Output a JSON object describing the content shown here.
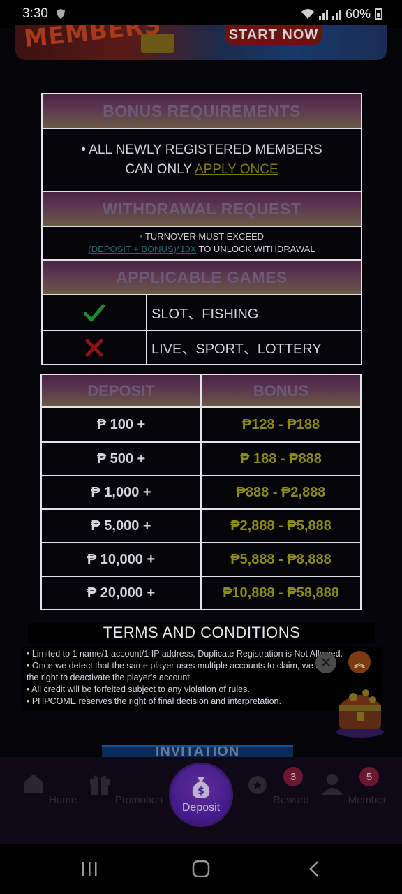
{
  "status_bar": {
    "time": "3:30",
    "battery": "60%"
  },
  "banner": {
    "members_text": "MEMBERS",
    "button_label": "START NOW"
  },
  "bonus_requirements": {
    "header": "BONUS REQUIREMENTS",
    "line1": "• ALL NEWLY REGISTERED MEMBERS",
    "line2_prefix": "CAN ONLY ",
    "line2_link": "APPLY ONCE"
  },
  "withdrawal_request": {
    "header": "WITHDRAWAL REQUEST",
    "line1_dot": "•",
    "line1": " TURNOVER MUST EXCEED",
    "line2_link": "(DEPOSIT + BONUS)*10X",
    "line2_suffix": " TO UNLOCK WITHDRAWAL"
  },
  "applicable_games": {
    "header": "APPLICABLE GAMES",
    "allowed": "SLOT、FISHING",
    "not_allowed": "LIVE、SPORT、LOTTERY",
    "colors": {
      "check": "#1f8a2a",
      "cross": "#8a1512"
    }
  },
  "deposit_table": {
    "headers": [
      "DEPOSIT",
      "BONUS"
    ],
    "rows": [
      {
        "deposit": "₱ 100 +",
        "bonus": "₱128 - ₱188"
      },
      {
        "deposit": "₱ 500 +",
        "bonus": "₱ 188 - ₱888"
      },
      {
        "deposit": "₱ 1,000 +",
        "bonus": "₱888 - ₱2,888"
      },
      {
        "deposit": "₱ 5,000 +",
        "bonus": "₱2,888 - ₱5,888"
      },
      {
        "deposit": "₱ 10,000 +",
        "bonus": "₱5,888 - ₱8,888"
      },
      {
        "deposit": "₱ 20,000 +",
        "bonus": "₱10,888 - ₱58,888"
      }
    ]
  },
  "terms": {
    "title": "TERMS AND CONDITIONS",
    "lines": [
      "• Limited to 1 name/1 account/1 IP address, Duplicate Registration is Not Allowed.",
      "• Once we detect that the same player uses multiple accounts to claim, we have",
      "the right to deactivate the player's account.",
      "• All credit will be forfeited subject to any violation of rules.",
      "• PHPCOME reserves the right of final decision and interpretation."
    ]
  },
  "invitation_label": "INVITATION",
  "bottom_nav": {
    "home": "Home",
    "promotion": "Promotion",
    "deposit": "Deposit",
    "reward": "Reward",
    "member": "Member",
    "reward_badge": "3",
    "member_badge": "5"
  }
}
